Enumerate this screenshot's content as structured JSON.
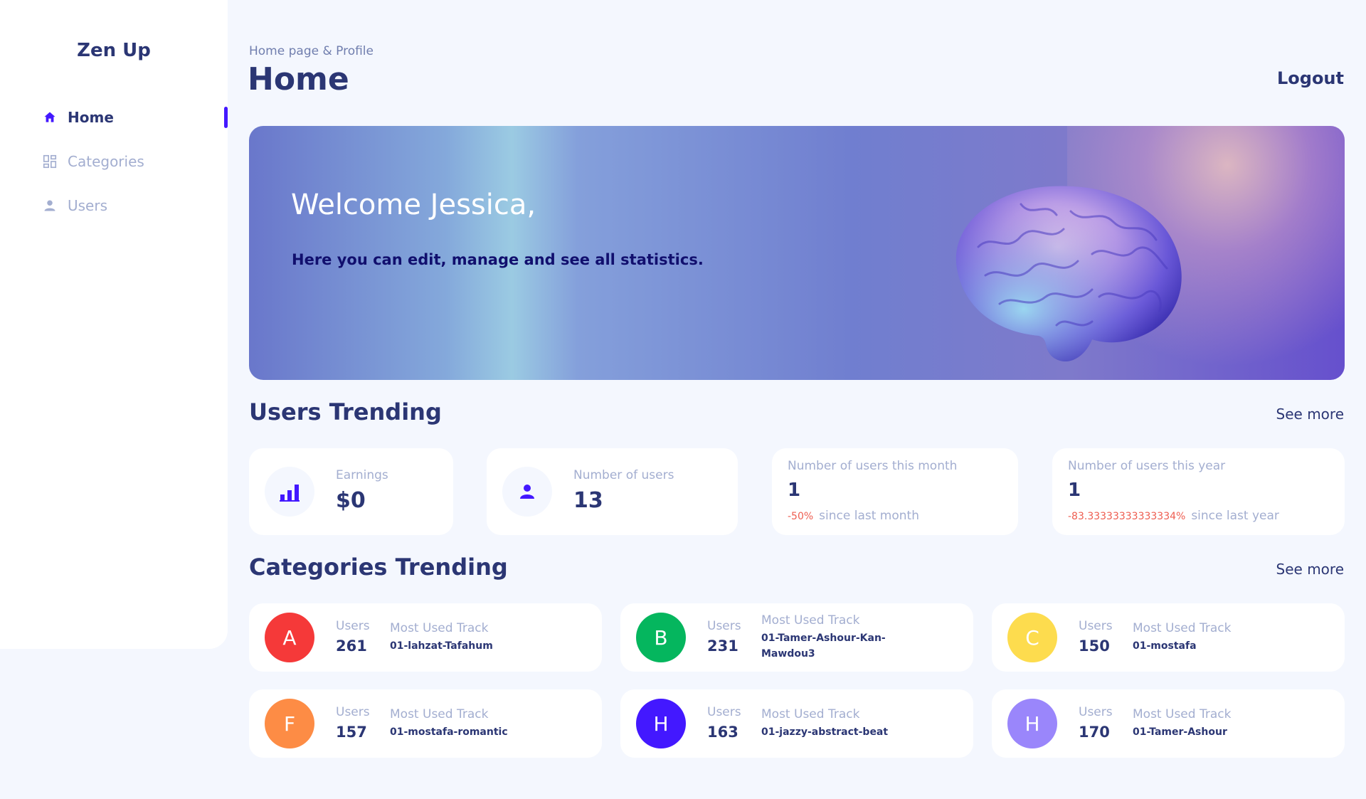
{
  "app": {
    "brand": "Zen Up"
  },
  "sidebar": {
    "items": [
      {
        "label": "Home",
        "icon": "home-icon",
        "active": true
      },
      {
        "label": "Categories",
        "icon": "grid-icon",
        "active": false
      },
      {
        "label": "Users",
        "icon": "person-icon",
        "active": false
      }
    ]
  },
  "header": {
    "breadcrumb": "Home page & Profile",
    "title": "Home",
    "logout_label": "Logout"
  },
  "banner": {
    "title": "Welcome Jessica,",
    "subtitle": "Here you can edit, manage and see all statistics."
  },
  "users_trending": {
    "title": "Users Trending",
    "see_more": "See more",
    "earnings": {
      "label": "Earnings",
      "value": "$0"
    },
    "users": {
      "label": "Number of users",
      "value": "13"
    },
    "month": {
      "label": "Number of users this month",
      "value": "1",
      "change": "-50%",
      "since": "since last month"
    },
    "year": {
      "label": "Number of users this year",
      "value": "1",
      "change": "-83.33333333333334%",
      "since": "since last year"
    }
  },
  "categories_trending": {
    "title": "Categories Trending",
    "see_more": "See more",
    "users_label": "Users",
    "track_label": "Most Used Track",
    "items": [
      {
        "letter": "A",
        "color": "#f53939",
        "users": "261",
        "track": "01-lahzat-Tafahum"
      },
      {
        "letter": "B",
        "color": "#05b65e",
        "users": "231",
        "track": "01-Tamer-Ashour-Kan-Mawdou3"
      },
      {
        "letter": "C",
        "color": "#fddc4e",
        "users": "150",
        "track": "01-mostafa"
      },
      {
        "letter": "F",
        "color": "#fd8c45",
        "users": "157",
        "track": "01-mostafa-romantic"
      },
      {
        "letter": "H",
        "color": "#4318ff",
        "users": "163",
        "track": "01-jazzy-abstract-beat"
      },
      {
        "letter": "H",
        "color": "#9a86fb",
        "users": "170",
        "track": "01-Tamer-Ashour"
      }
    ]
  },
  "colors": {
    "accent": "#4318ff",
    "navy": "#2b3674",
    "muted": "#a3aed0",
    "negative": "#ee5d50"
  }
}
